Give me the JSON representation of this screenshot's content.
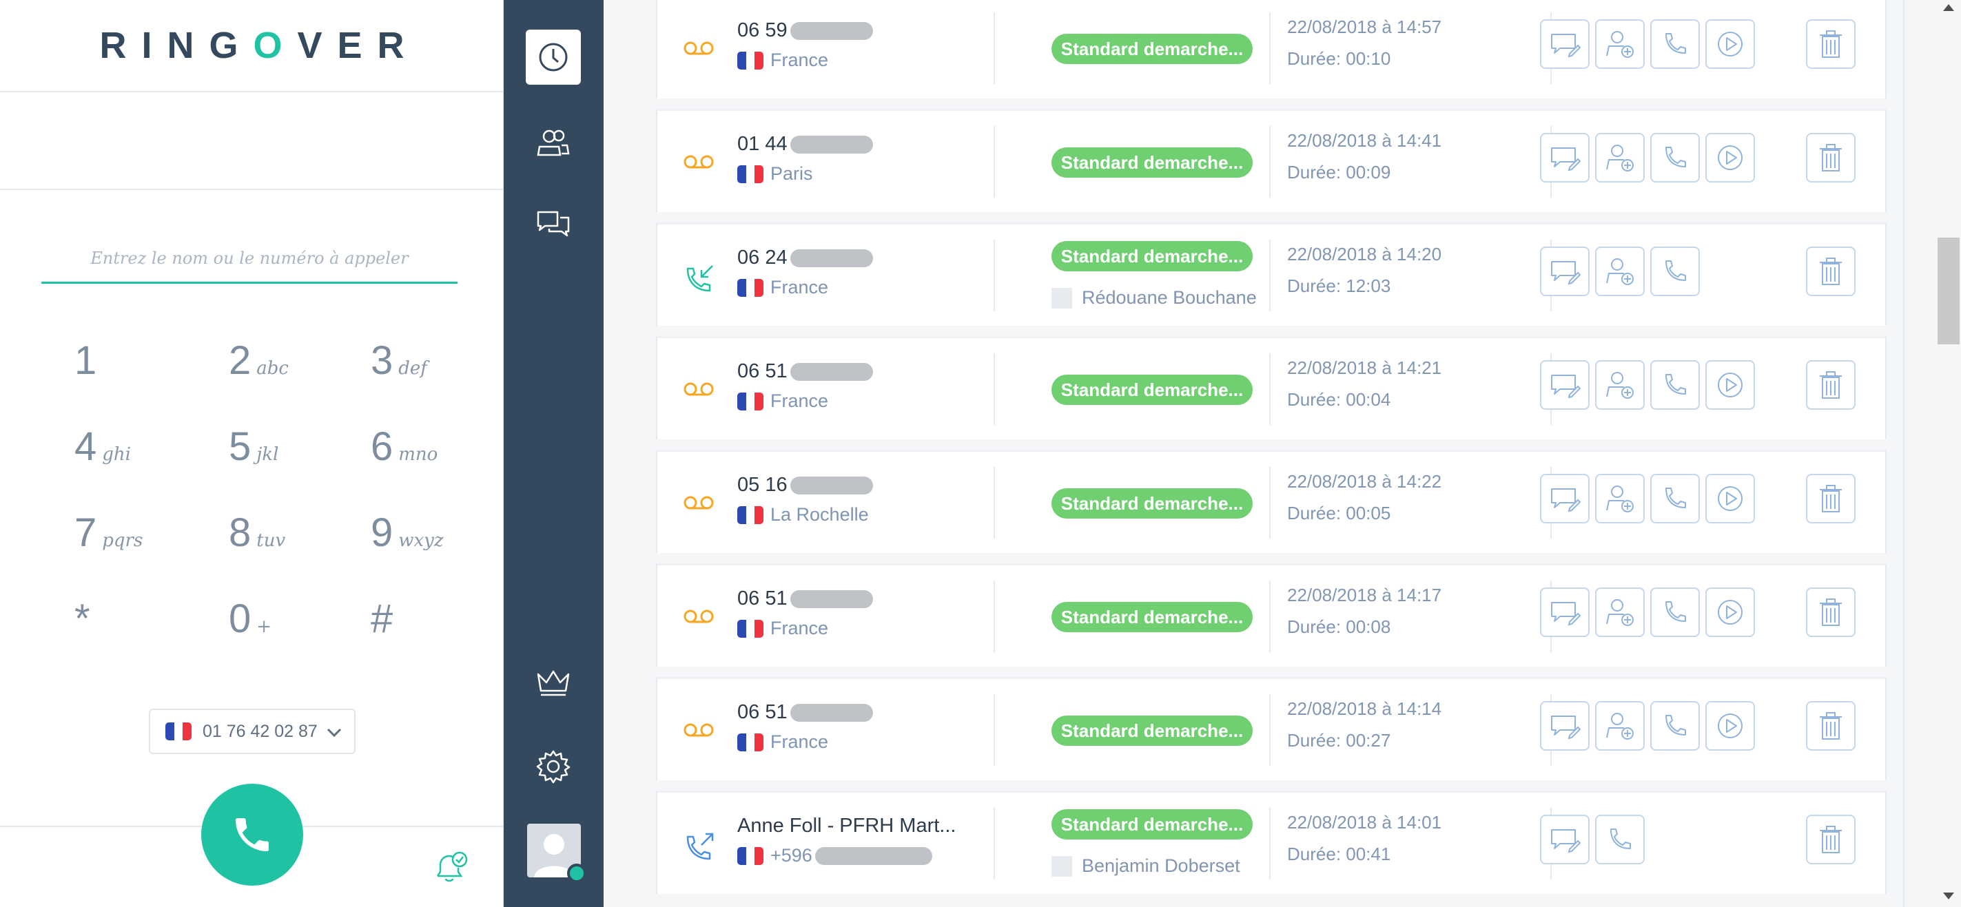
{
  "brand": {
    "name_before": "RING",
    "name_o": "O",
    "name_after": "VER"
  },
  "dialer": {
    "placeholder": "Entrez le nom ou le numéro à appeler",
    "keys": [
      {
        "digit": "1",
        "letters": ""
      },
      {
        "digit": "2",
        "letters": "abc"
      },
      {
        "digit": "3",
        "letters": "def"
      },
      {
        "digit": "4",
        "letters": "ghi"
      },
      {
        "digit": "5",
        "letters": "jkl"
      },
      {
        "digit": "6",
        "letters": "mno"
      },
      {
        "digit": "7",
        "letters": "pqrs"
      },
      {
        "digit": "8",
        "letters": "tuv"
      },
      {
        "digit": "9",
        "letters": "wxyz"
      },
      {
        "digit": "*",
        "letters": ""
      },
      {
        "digit": "0",
        "letters": "+"
      },
      {
        "digit": "#",
        "letters": ""
      }
    ],
    "line_number": "01 76 42 02 87"
  },
  "nav": {
    "items": [
      "history-icon",
      "contacts-icon",
      "chat-icon",
      "crown-icon",
      "settings-icon"
    ],
    "presence_color": "#1fc3a4"
  },
  "colors": {
    "accent": "#1fc3a4",
    "nav_bg": "#34495e",
    "badge": "#6fcf71",
    "voicemail": "#f5a623",
    "incoming": "#1fc3a4",
    "outgoing": "#4a90e2"
  },
  "calls": [
    {
      "type": "voicemail",
      "number": "06 59",
      "location": "France",
      "badge": "Standard demarche...",
      "agent": "",
      "date": "22/08/2018 à 14:57",
      "duration": "Durée: 00:10",
      "actions": [
        "comment",
        "add-contact",
        "call",
        "play"
      ]
    },
    {
      "type": "voicemail",
      "number": "01 44",
      "location": "Paris",
      "badge": "Standard demarche...",
      "agent": "",
      "date": "22/08/2018 à 14:41",
      "duration": "Durée: 00:09",
      "actions": [
        "comment",
        "add-contact",
        "call",
        "play"
      ]
    },
    {
      "type": "incoming",
      "number": "06 24",
      "location": "France",
      "badge": "Standard demarche...",
      "agent": "Rédouane Bouchane",
      "date": "22/08/2018 à 14:20",
      "duration": "Durée: 12:03",
      "actions": [
        "comment",
        "add-contact",
        "call"
      ]
    },
    {
      "type": "voicemail",
      "number": "06 51",
      "location": "France",
      "badge": "Standard demarche...",
      "agent": "",
      "date": "22/08/2018 à 14:21",
      "duration": "Durée: 00:04",
      "actions": [
        "comment",
        "add-contact",
        "call",
        "play"
      ]
    },
    {
      "type": "voicemail",
      "number": "05 16",
      "location": "La Rochelle",
      "badge": "Standard demarche...",
      "agent": "",
      "date": "22/08/2018 à 14:22",
      "duration": "Durée: 00:05",
      "actions": [
        "comment",
        "add-contact",
        "call",
        "play"
      ]
    },
    {
      "type": "voicemail",
      "number": "06 51",
      "location": "France",
      "badge": "Standard demarche...",
      "agent": "",
      "date": "22/08/2018 à 14:17",
      "duration": "Durée: 00:08",
      "actions": [
        "comment",
        "add-contact",
        "call",
        "play"
      ]
    },
    {
      "type": "voicemail",
      "number": "06 51",
      "location": "France",
      "badge": "Standard demarche...",
      "agent": "",
      "date": "22/08/2018 à 14:14",
      "duration": "Durée: 00:27",
      "actions": [
        "comment",
        "add-contact",
        "call",
        "play"
      ]
    },
    {
      "type": "outgoing",
      "number": "Anne Foll - PFRH Mart...",
      "location": "+596",
      "badge": "Standard demarche...",
      "agent": "Benjamin Doberset",
      "date": "22/08/2018 à 14:01",
      "duration": "Durée: 00:41",
      "actions": [
        "comment",
        "call"
      ]
    }
  ]
}
